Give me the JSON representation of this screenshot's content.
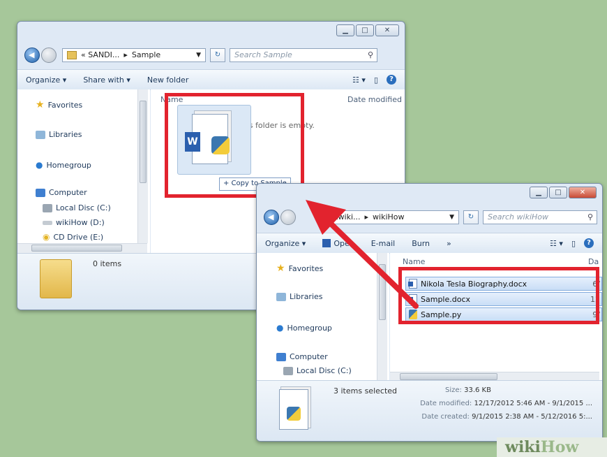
{
  "window1": {
    "path_root": "« SANDI...",
    "path_sep": "▸",
    "path_folder": "Sample",
    "search_placeholder": "Search Sample",
    "toolbar": {
      "organize": "Organize ▾",
      "share": "Share with ▾",
      "new_folder": "New folder"
    },
    "nav": {
      "favorites": "Favorites",
      "libraries": "Libraries",
      "homegroup": "Homegroup",
      "computer": "Computer",
      "local_disc": "Local Disc (C:)",
      "wikihow_drive": "wikiHow (D:)",
      "cd_drive": "CD Drive (E:)"
    },
    "col_name": "Name",
    "col_date": "Date modified",
    "empty_text": "This folder is empty.",
    "copy_tooltip": "+ Copy to Sample",
    "status_items": "0 items"
  },
  "window2": {
    "path_root": "Zwiki...",
    "path_sep": "▸",
    "path_folder": "wikiHow",
    "search_placeholder": "Search wikiHow",
    "toolbar": {
      "organize": "Organize ▾",
      "open": "Open",
      "email": "E-mail",
      "burn": "Burn",
      "more": "»"
    },
    "nav": {
      "favorites": "Favorites",
      "libraries": "Libraries",
      "homegroup": "Homegroup",
      "computer": "Computer",
      "local_disc": "Local Disc (C:)"
    },
    "col_name": "Name",
    "col_date": "Da",
    "files": [
      {
        "name": "Nikola Tesla Biography.docx",
        "date": "6/"
      },
      {
        "name": "Sample.docx",
        "date": "12"
      },
      {
        "name": "Sample.py",
        "date": "9/"
      }
    ],
    "status": {
      "selected": "3 items selected",
      "size_label": "Size:",
      "size_value": "33.6 KB",
      "modified_label": "Date modified:",
      "modified_value": "12/17/2012 5:46 AM - 9/1/2015 ...",
      "created_label": "Date created:",
      "created_value": "9/1/2015 2:38 AM - 5/12/2016 5:..."
    }
  },
  "watermark": {
    "wiki": "wiki",
    "how": "How"
  },
  "colors": {
    "highlight_red": "#e2232e",
    "background": "#a6c79a",
    "selection": "#c9def6"
  }
}
